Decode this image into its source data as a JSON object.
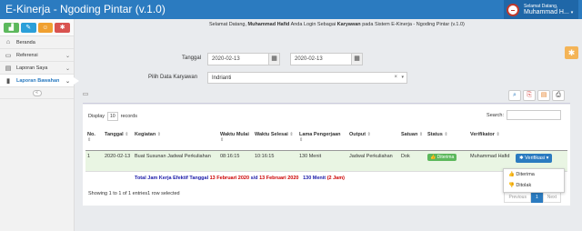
{
  "app": {
    "title": "E-Kinerja - Ngoding Pintar (v.1.0)"
  },
  "user": {
    "greeting": "Selamat Datang,",
    "name": "Muhammad H...",
    "caret": "▾"
  },
  "shortcuts": [
    {
      "icon": "bar-chart-icon",
      "glyph": "▟",
      "color": "#5cb85c"
    },
    {
      "icon": "pencil-icon",
      "glyph": "✎",
      "color": "#2b9fd9"
    },
    {
      "icon": "users-icon",
      "glyph": "☺",
      "color": "#f0a030"
    },
    {
      "icon": "gear-icon",
      "glyph": "✱",
      "color": "#d9534f"
    }
  ],
  "sidebar": {
    "items": [
      {
        "label": "Beranda",
        "glyph": "⌂",
        "chevron": ""
      },
      {
        "label": "Referensi",
        "glyph": "▭",
        "chevron": "⌄"
      },
      {
        "label": "Laporan Saya",
        "glyph": "▤",
        "chevron": "⌄"
      },
      {
        "label": "Laporan Bawahan",
        "glyph": "▮",
        "chevron": "⌄"
      }
    ],
    "collapse": "«"
  },
  "welcome": {
    "prefix": "Selamat Datang,",
    "name": "Muhammad Hafid",
    "middle": "Anda Login Sebagai",
    "role": "Karyawan",
    "suffix": "pada Sistem E-Kinerja - Ngoding Pintar (v.1.0)"
  },
  "filter": {
    "tanggal_label": "Tanggal",
    "date_from": "2020-02-13",
    "date_to": "2020-02-13",
    "calendar_glyph": "▦",
    "karyawan_label": "Pilih Data Karyawan",
    "karyawan_value": "Indrianti",
    "clear_glyph": "×",
    "dropdown_glyph": "▾"
  },
  "toolbar": {
    "search": "⌕",
    "copy": "⎘",
    "excel": "▤",
    "print": "⎙"
  },
  "table_controls": {
    "display_label": "Display",
    "display_value": "10",
    "records_label": "records",
    "search_label": "Search:"
  },
  "table": {
    "headers": [
      "No.",
      "Tanggal",
      "Kegiatan",
      "Waktu Mulai",
      "Waktu Selesai",
      "Lama Pengerjaan",
      "Output",
      "Satuan",
      "Status",
      "Verifikator",
      ""
    ],
    "sort_glyph": "⇕",
    "rows": [
      {
        "no": "1",
        "tanggal": "2020-02-13",
        "kegiatan": "Buat Susunan Jadwal Perkuliahan",
        "mulai": "08:16:15",
        "selesai": "10:16:15",
        "lama": "130 Menit",
        "output": "Jadwal Perkuliahan",
        "satuan": "Dok",
        "status": "Diterima",
        "verifikator": "Muhammad Hafid",
        "action": "Verifikasi"
      }
    ],
    "total": {
      "label": "Total Jam Kerja Efektif Tanggal",
      "date_from": "13 Februari 2020",
      "sd": "s/d",
      "date_to": "13 Februari 2020",
      "minutes": "130 Menit",
      "hours": "(2 Jam)"
    }
  },
  "footer": {
    "info": "Showing 1 to 1 of 1 entries1 row selected",
    "prev": "Previous",
    "page": "1",
    "next": "Next"
  },
  "dropdown_menu": {
    "accept": "Diterima",
    "reject": "Ditolak"
  }
}
